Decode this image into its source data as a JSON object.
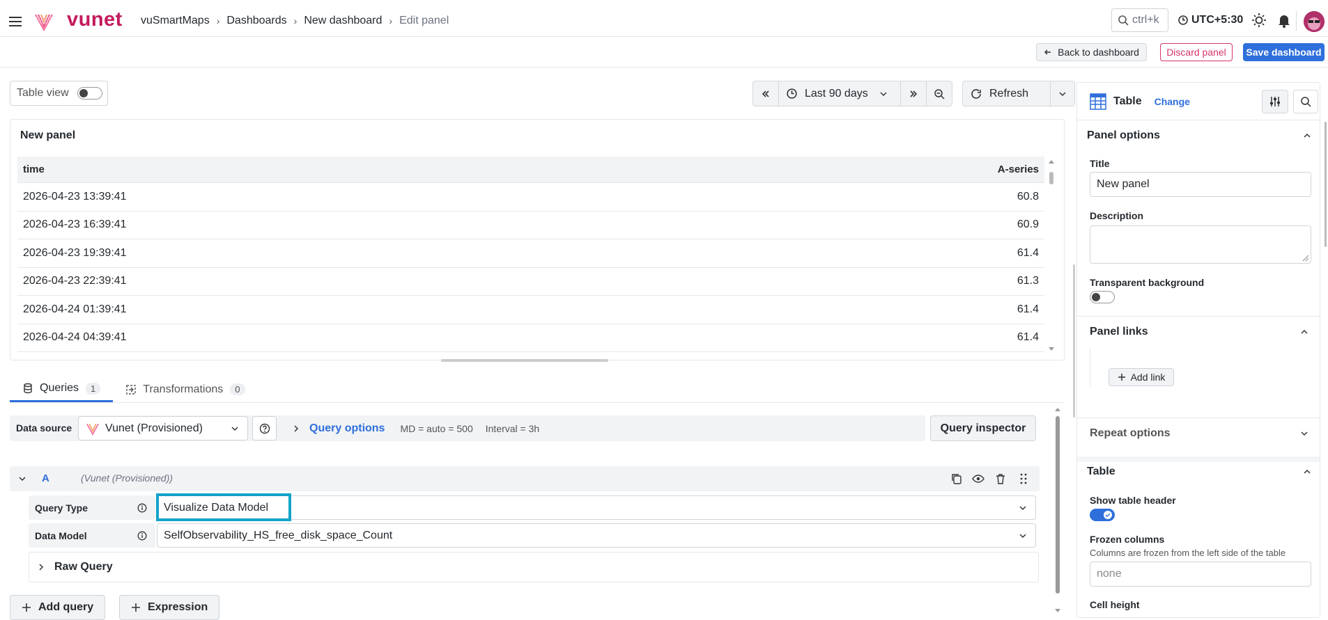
{
  "header": {
    "brand": "vunet",
    "breadcrumbs": [
      "vuSmartMaps",
      "Dashboards",
      "New dashboard",
      "Edit panel"
    ],
    "search_shortcut": "ctrl+k",
    "timezone": "UTC+5:30"
  },
  "actions": {
    "back": "Back to dashboard",
    "discard": "Discard panel",
    "save": "Save dashboard"
  },
  "toolbar": {
    "table_view": "Table view",
    "time_range": "Last 90 days",
    "refresh": "Refresh"
  },
  "panel": {
    "title": "New panel",
    "columns": [
      "time",
      "A-series"
    ],
    "rows": [
      [
        "2026-04-23 13:39:41",
        "60.8"
      ],
      [
        "2026-04-23 16:39:41",
        "60.9"
      ],
      [
        "2026-04-23 19:39:41",
        "61.4"
      ],
      [
        "2026-04-23 22:39:41",
        "61.3"
      ],
      [
        "2026-04-24 01:39:41",
        "61.4"
      ],
      [
        "2026-04-24 04:39:41",
        "61.4"
      ]
    ]
  },
  "tabs": [
    {
      "label": "Queries",
      "count": "1"
    },
    {
      "label": "Transformations",
      "count": "0"
    }
  ],
  "query": {
    "datasource_label": "Data source",
    "datasource": "Vunet (Provisioned)",
    "options_label": "Query options",
    "md": "MD = auto = 500",
    "interval": "Interval = 3h",
    "inspector": "Query inspector",
    "ref_id": "A",
    "ref_source": "(Vunet (Provisioned))",
    "type_label": "Query Type",
    "type_value": "Visualize Data Model",
    "model_label": "Data Model",
    "model_value": "SelfObservability_HS_free_disk_space_Count",
    "raw_query": "Raw Query",
    "add_query": "Add query",
    "expression": "Expression"
  },
  "sidebar": {
    "viz": "Table",
    "change": "Change",
    "panel_options": "Panel options",
    "title_label": "Title",
    "title_value": "New panel",
    "description_label": "Description",
    "transparent_label": "Transparent background",
    "panel_links": "Panel links",
    "add_link": "Add link",
    "repeat_options": "Repeat options",
    "table_section": "Table",
    "show_header": "Show table header",
    "frozen_label": "Frozen columns",
    "frozen_desc": "Columns are frozen from the left side of the table",
    "frozen_value": "none",
    "cell_height": "Cell height"
  },
  "colors": {
    "brand": "#c41a5d",
    "primary": "#2f6fdc",
    "highlight": "#13a4c9"
  }
}
